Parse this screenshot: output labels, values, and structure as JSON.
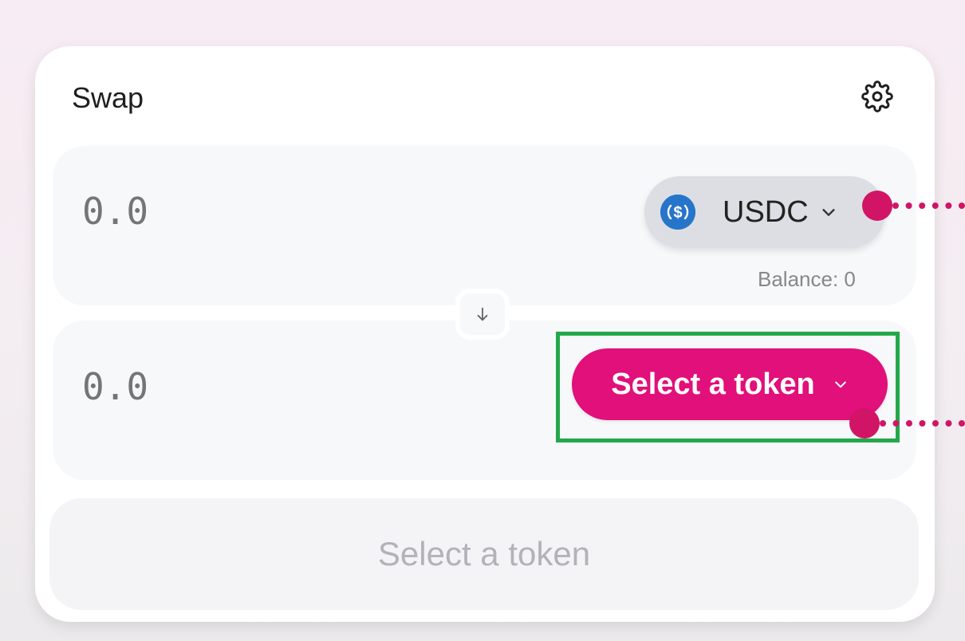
{
  "header": {
    "title": "Swap",
    "settings_icon": "gear-icon"
  },
  "input_panel": {
    "amount_placeholder": "0.0",
    "token": {
      "symbol": "USDC",
      "icon": "usdc-logo-icon",
      "chevron_icon": "chevron-down-icon"
    },
    "balance_text": "Balance: 0"
  },
  "switch": {
    "icon": "arrow-down-icon"
  },
  "output_panel": {
    "amount_placeholder": "0.0",
    "select_token_label": "Select a token",
    "chevron_icon": "chevron-down-icon"
  },
  "action_button": {
    "label": "Select a token"
  },
  "colors": {
    "accent": "#e1107a",
    "annotation": "#d11466",
    "highlight": "#23a84a",
    "usdc": "#2775ca"
  }
}
